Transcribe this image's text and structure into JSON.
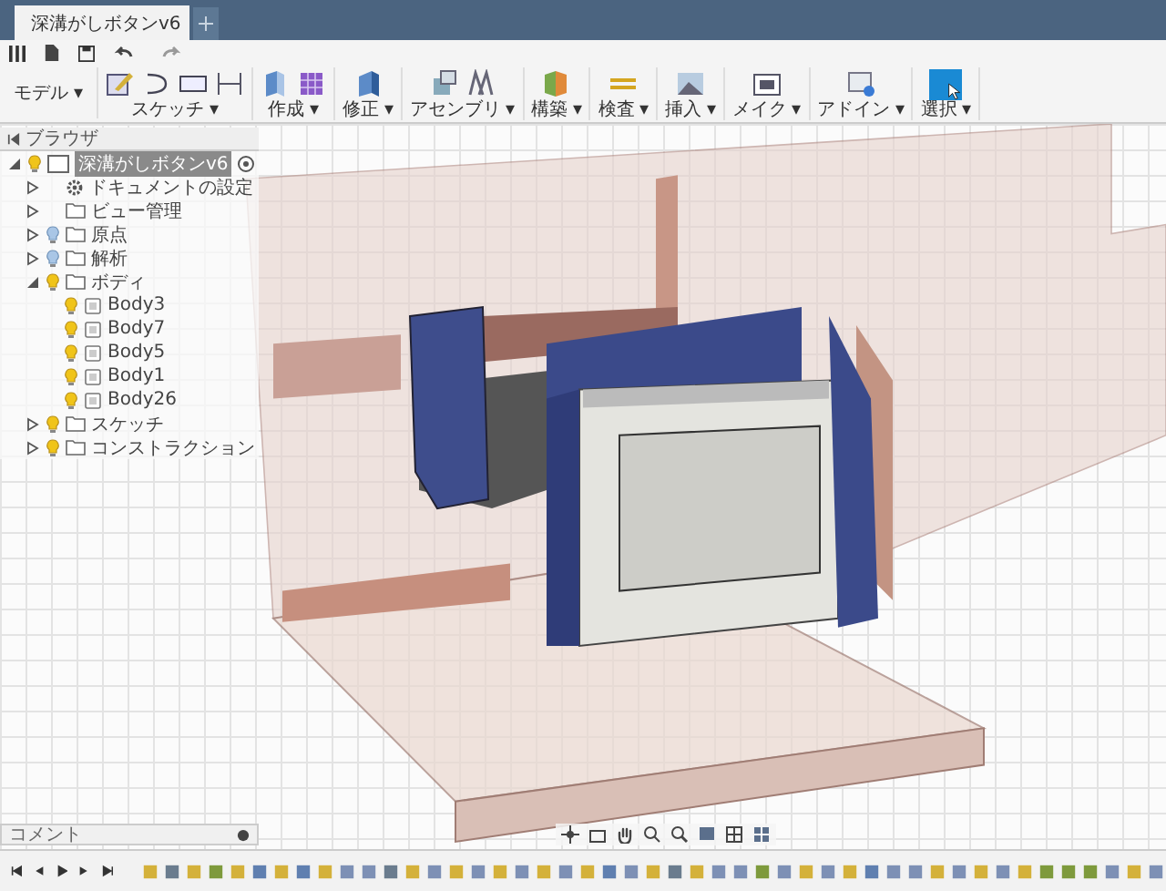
{
  "window": {
    "tab_title": "深溝がしボタンv6"
  },
  "ribbon": {
    "workspace": "モデル ▾",
    "groups": [
      {
        "label": "スケッチ ▾",
        "kind": "sketch"
      },
      {
        "label": "作成 ▾",
        "kind": "create"
      },
      {
        "label": "修正 ▾",
        "kind": "modify"
      },
      {
        "label": "アセンブリ ▾",
        "kind": "assemble"
      },
      {
        "label": "構築 ▾",
        "kind": "construct"
      },
      {
        "label": "検査 ▾",
        "kind": "inspect"
      },
      {
        "label": "挿入 ▾",
        "kind": "insert"
      },
      {
        "label": "メイク ▾",
        "kind": "make"
      },
      {
        "label": "アドイン ▾",
        "kind": "addin"
      },
      {
        "label": "選択 ▾",
        "kind": "select",
        "selected": true
      }
    ]
  },
  "browser": {
    "title": "ブラウザ",
    "root": {
      "label": "深溝がしボタンv6",
      "selected": true,
      "expanded": true,
      "visible": true,
      "children": [
        {
          "label": "ドキュメントの設定",
          "kind": "settings",
          "expanded": false
        },
        {
          "label": "ビュー管理",
          "kind": "folder",
          "expanded": false
        },
        {
          "label": "原点",
          "kind": "folder",
          "expanded": false,
          "visible": false
        },
        {
          "label": "解析",
          "kind": "folder",
          "expanded": false,
          "visible": false
        },
        {
          "label": "ボディ",
          "kind": "folder",
          "expanded": true,
          "visible": true,
          "children": [
            {
              "label": "Body3",
              "kind": "body",
              "visible": true
            },
            {
              "label": "Body7",
              "kind": "body",
              "visible": true
            },
            {
              "label": "Body5",
              "kind": "body",
              "visible": true
            },
            {
              "label": "Body1",
              "kind": "body",
              "visible": true
            },
            {
              "label": "Body26",
              "kind": "body",
              "visible": true
            }
          ]
        },
        {
          "label": "スケッチ",
          "kind": "folder",
          "expanded": false,
          "visible": true
        },
        {
          "label": "コンストラクション",
          "kind": "folder",
          "expanded": false,
          "visible": true
        }
      ]
    }
  },
  "comments": {
    "label": "コメント"
  }
}
